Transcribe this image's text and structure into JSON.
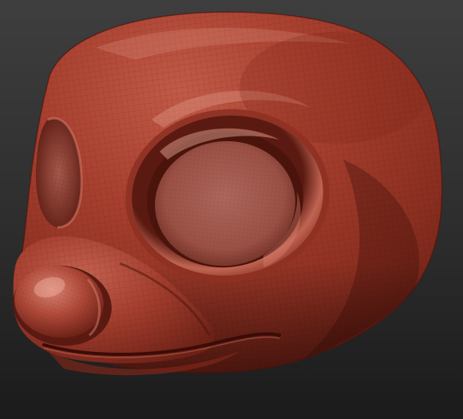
{
  "viewport": {
    "background_top": "#3d3d3d",
    "background_bottom": "#1c1c1c"
  },
  "model": {
    "material_color": "#9b3a2c",
    "highlight_color": "#d98878",
    "shadow_color": "#4a1510",
    "wireframe_color": "#3a0e08"
  }
}
